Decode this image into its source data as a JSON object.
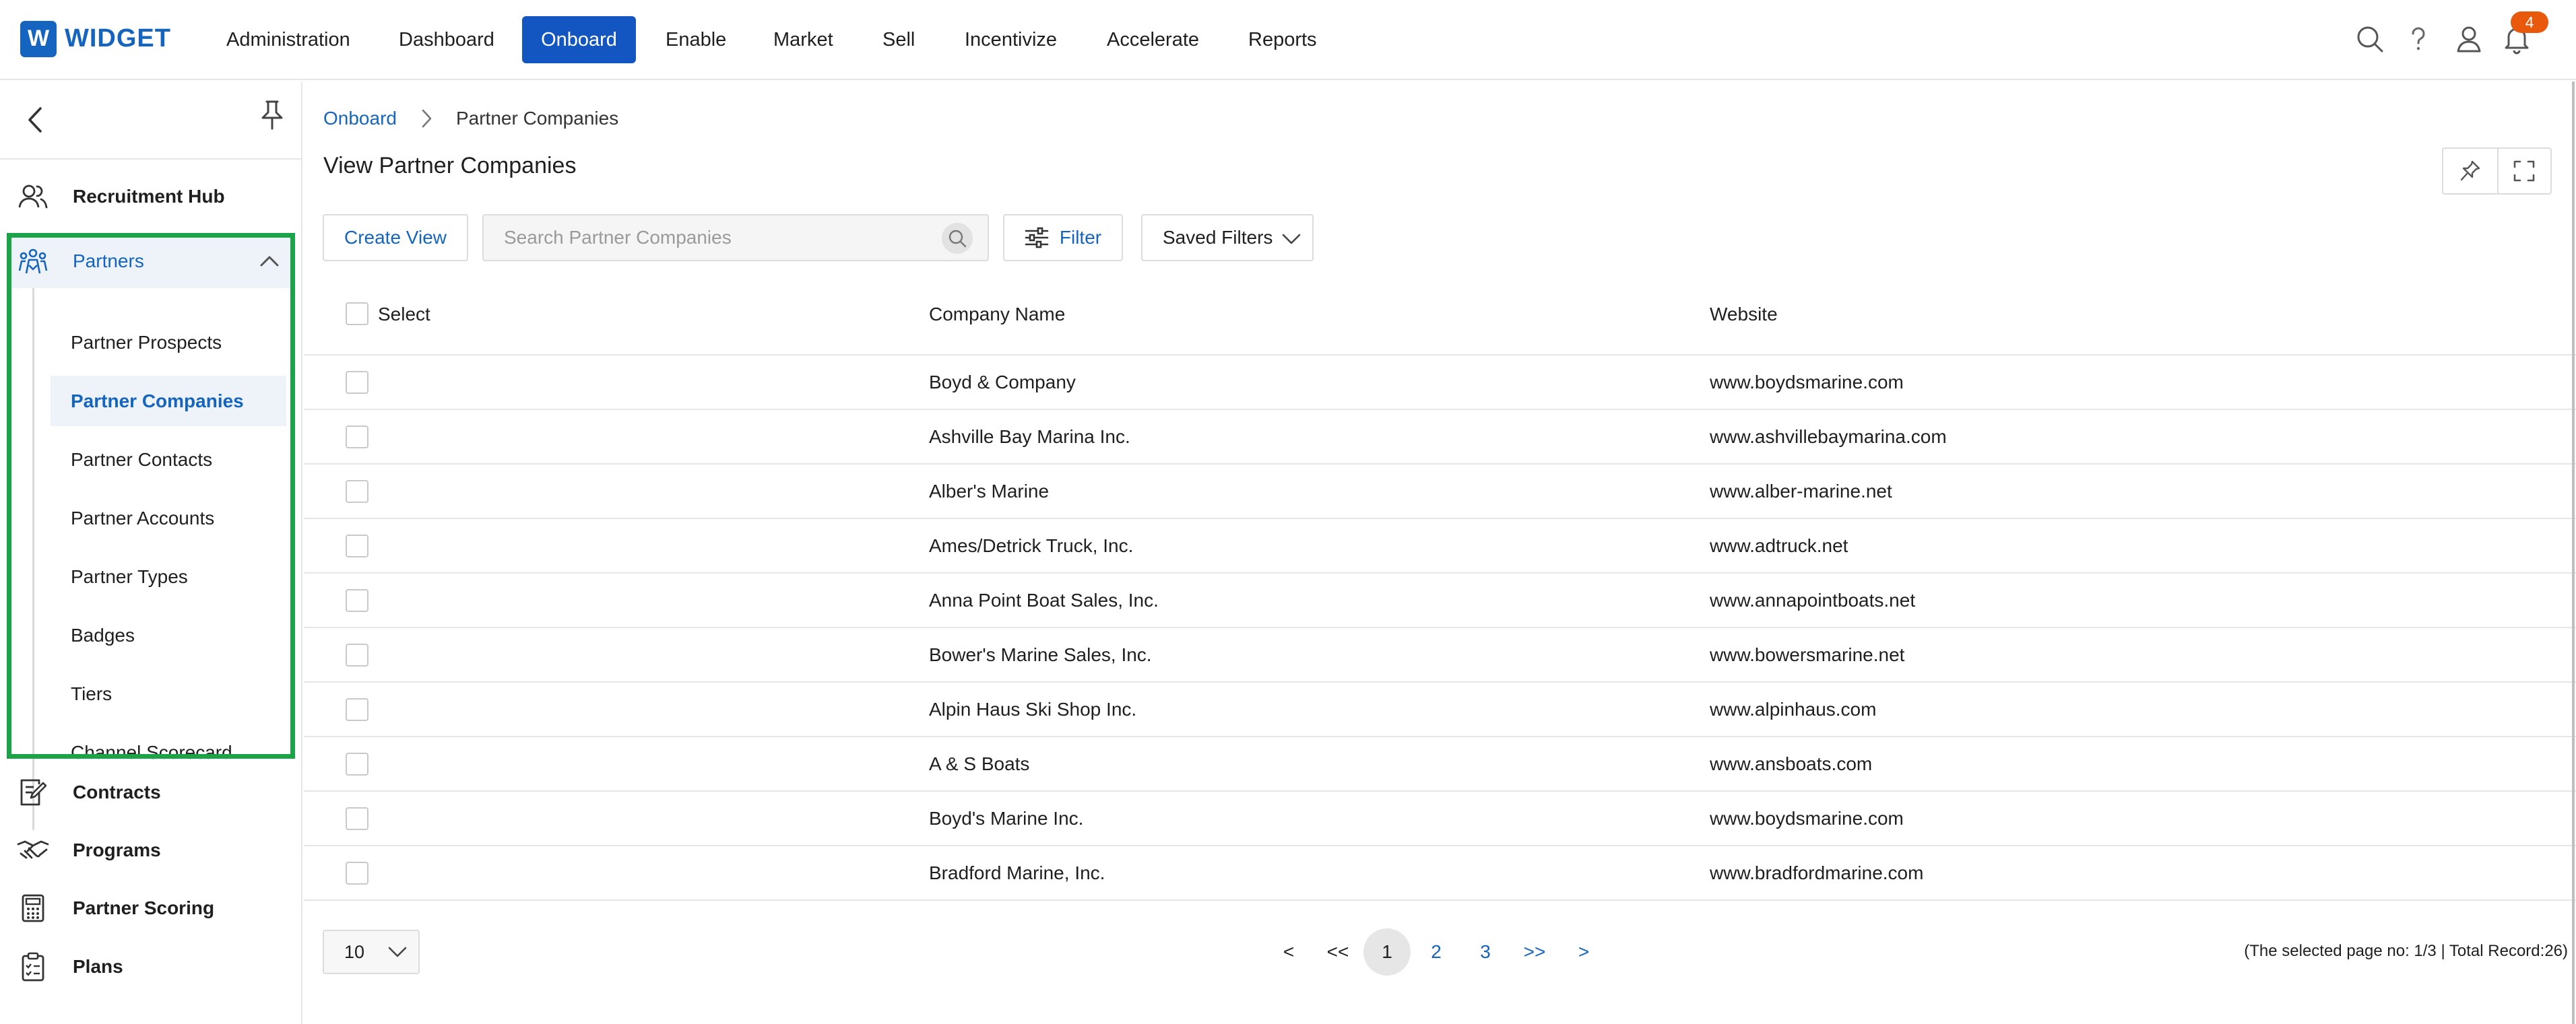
{
  "brand": {
    "logo_letter": "W",
    "name": "WIDGET",
    "color": "#1565c0"
  },
  "nav": {
    "items": [
      {
        "label": "Administration"
      },
      {
        "label": "Dashboard"
      },
      {
        "label": "Onboard",
        "active": true
      },
      {
        "label": "Enable"
      },
      {
        "label": "Market"
      },
      {
        "label": "Sell"
      },
      {
        "label": "Incentivize"
      },
      {
        "label": "Accelerate"
      },
      {
        "label": "Reports"
      }
    ],
    "notifications_count": "4",
    "icons": [
      "search-icon",
      "help-icon",
      "user-icon",
      "bell-icon"
    ]
  },
  "sidebar": {
    "items_top": [
      {
        "label": "Recruitment Hub",
        "icon": "people-icon"
      }
    ],
    "partners": {
      "label": "Partners",
      "icon": "partners-icon",
      "sub_items": [
        {
          "label": "Partner Prospects"
        },
        {
          "label": "Partner Companies",
          "active": true
        },
        {
          "label": "Partner Contacts"
        },
        {
          "label": "Partner Accounts"
        },
        {
          "label": "Partner Types"
        },
        {
          "label": "Badges"
        },
        {
          "label": "Tiers"
        },
        {
          "label": "Channel Scorecard"
        }
      ]
    },
    "items_bottom": [
      {
        "label": "Contracts",
        "icon": "contract-icon"
      },
      {
        "label": "Programs",
        "icon": "handshake-icon"
      },
      {
        "label": "Partner Scoring",
        "icon": "calculator-icon"
      },
      {
        "label": "Plans",
        "icon": "checklist-icon"
      }
    ]
  },
  "breadcrumb": {
    "parent": "Onboard",
    "current": "Partner Companies"
  },
  "page": {
    "title": "View Partner Companies",
    "create_view_label": "Create View",
    "search_placeholder": "Search Partner Companies",
    "filter_label": "Filter",
    "saved_filters_label": "Saved Filters"
  },
  "table": {
    "columns": [
      "Select",
      "Company Name",
      "Website"
    ],
    "rows": [
      {
        "company": "Boyd & Company",
        "website": "www.boydsmarine.com"
      },
      {
        "company": "Ashville Bay Marina Inc.",
        "website": "www.ashvillebaymarina.com"
      },
      {
        "company": "Alber's Marine",
        "website": "www.alber-marine.net"
      },
      {
        "company": "Ames/Detrick Truck, Inc.",
        "website": "www.adtruck.net"
      },
      {
        "company": "Anna Point Boat Sales, Inc.",
        "website": "www.annapointboats.net"
      },
      {
        "company": "Bower's Marine Sales, Inc.",
        "website": "www.bowersmarine.net"
      },
      {
        "company": "Alpin Haus Ski Shop Inc.",
        "website": "www.alpinhaus.com"
      },
      {
        "company": "A & S Boats",
        "website": "www.ansboats.com"
      },
      {
        "company": "Boyd's Marine Inc.",
        "website": "www.boydsmarine.com"
      },
      {
        "company": "Bradford Marine, Inc.",
        "website": "www.bradfordmarine.com"
      }
    ]
  },
  "pagination": {
    "page_size": "10",
    "prev": "<",
    "first": "<<",
    "pages": [
      "1",
      "2",
      "3"
    ],
    "current_page": "1",
    "last": ">>",
    "next": ">",
    "info": "(The selected page no: 1/3 | Total Record:26)"
  },
  "colors": {
    "accent": "#1456c1",
    "highlight_box": "#1aa447",
    "badge": "#e8590c"
  }
}
